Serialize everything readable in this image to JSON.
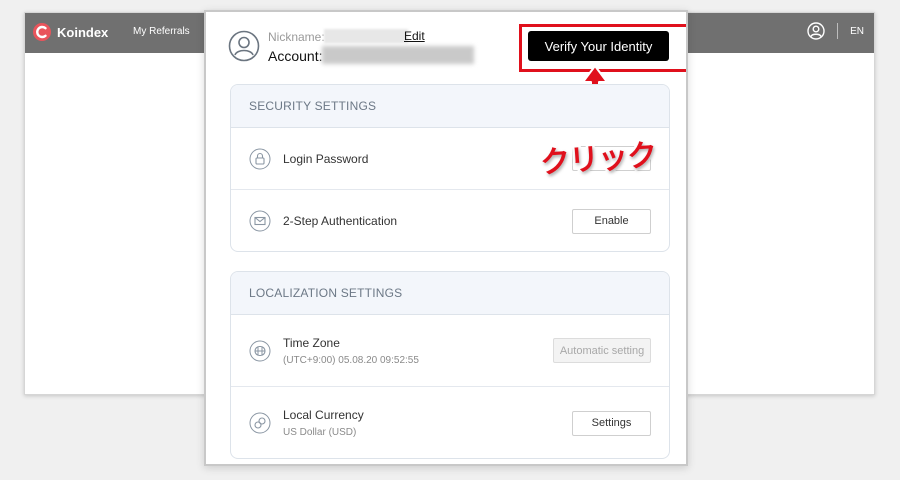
{
  "app": {
    "logo_text": "Koindex",
    "nav_referrals": "My Referrals",
    "language": "EN",
    "accent_color": "#e9545b"
  },
  "profile": {
    "nickname_label": "Nickname:",
    "edit_label": "Edit",
    "account_label": "Account:",
    "verify_button": "Verify Your Identity"
  },
  "annotation": {
    "callout_text": "クリック",
    "highlight_color": "#e0101c"
  },
  "security": {
    "header": "SECURITY SETTINGS",
    "rows": [
      {
        "icon": "lock-icon",
        "title": "Login Password",
        "button": ""
      },
      {
        "icon": "envelope-icon",
        "title": "2-Step Authentication",
        "button": "Enable"
      }
    ]
  },
  "localization": {
    "header": "LOCALIZATION SETTINGS",
    "rows": [
      {
        "icon": "clock-icon",
        "title": "Time Zone",
        "subtitle": "(UTC+9:00) 05.08.20 09:52:55",
        "button": "Automatic setting",
        "button_disabled": true
      },
      {
        "icon": "currency-icon",
        "title": "Local Currency",
        "subtitle": "US Dollar (USD)",
        "button": "Settings",
        "button_disabled": false
      }
    ]
  }
}
